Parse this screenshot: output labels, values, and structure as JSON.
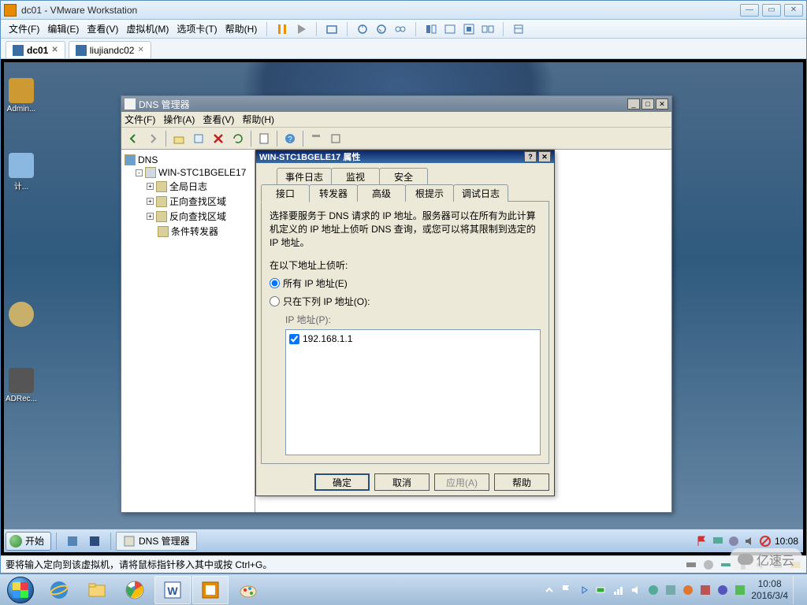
{
  "vmware": {
    "title": "dc01 - VMware Workstation",
    "menus": [
      "文件(F)",
      "编辑(E)",
      "查看(V)",
      "虚拟机(M)",
      "选项卡(T)",
      "帮助(H)"
    ],
    "tabs": [
      {
        "label": "dc01",
        "active": true
      },
      {
        "label": "liujiandc02",
        "active": false
      }
    ],
    "status_msg": "要将输入定向到该虚拟机，请将鼠标指针移入其中或按 Ctrl+G。"
  },
  "guest": {
    "desktop_icons": [
      "Admin...",
      "计...",
      "",
      "ADRec..."
    ],
    "taskbar": {
      "start": "开始",
      "task_label": "DNS 管理器",
      "time": "10:08"
    }
  },
  "dns": {
    "window_title": "DNS 管理器",
    "menus": [
      "文件(F)",
      "操作(A)",
      "查看(V)",
      "帮助(H)"
    ],
    "tree": {
      "root": "DNS",
      "server": "WIN-STC1BGELE17",
      "children": [
        "全局日志",
        "正向查找区域",
        "反向查找区域",
        "条件转发器"
      ]
    }
  },
  "props": {
    "title": "WIN-STC1BGELE17 属性",
    "tabs_row1": [
      "事件日志",
      "监视",
      "安全"
    ],
    "tabs_row2": [
      "接口",
      "转发器",
      "高级",
      "根提示",
      "调试日志"
    ],
    "active_tab": "接口",
    "description": "选择要服务于 DNS 请求的 IP 地址。服务器可以在所有为此计算机定义的 IP 地址上侦听 DNS 查询，或您可以将其限制到选定的 IP 地址。",
    "listen_label": "在以下地址上侦听:",
    "radio_all": "所有 IP 地址(E)",
    "radio_only": "只在下列 IP 地址(O):",
    "ip_label": "IP 地址(P):",
    "ip_entries": [
      {
        "value": "192.168.1.1",
        "checked": true
      }
    ],
    "buttons": {
      "ok": "确定",
      "cancel": "取消",
      "apply": "应用(A)",
      "help": "帮助"
    }
  },
  "host": {
    "time": "10:08",
    "date": "2016/3/4"
  },
  "watermark": "亿速云"
}
